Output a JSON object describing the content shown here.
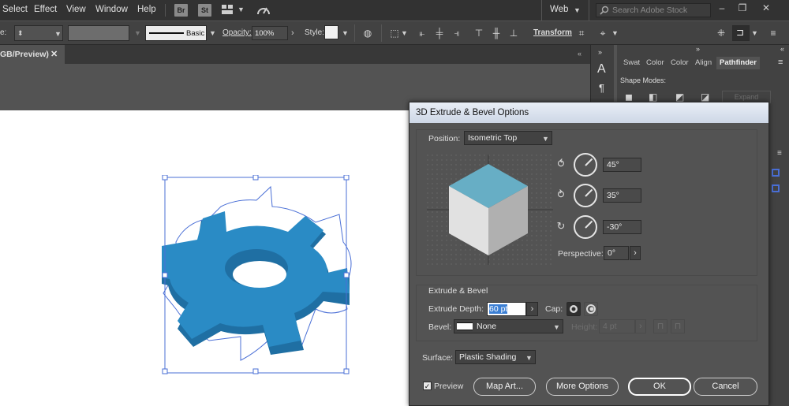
{
  "menubar": {
    "items": [
      "Select",
      "Effect",
      "View",
      "Window",
      "Help"
    ],
    "bridge": "Br",
    "stock": "St",
    "workspace": "Web",
    "search_placeholder": "Search Adobe Stock"
  },
  "controlbar": {
    "stroke_style": "Basic",
    "opacity_label": "Opacity:",
    "opacity_value": "100%",
    "style_label": "Style:",
    "transform": "Transform"
  },
  "document": {
    "tab_title": "GB/Preview)"
  },
  "panel": {
    "tabs": [
      "Swat",
      "Color",
      "Color",
      "Align",
      "Pathfinder"
    ],
    "shape_modes": "Shape Modes:",
    "expand": "Expand"
  },
  "dialog": {
    "title": "3D Extrude & Bevel Options",
    "position_label": "Position:",
    "position_value": "Isometric Top",
    "x_angle": "45°",
    "y_angle": "35°",
    "z_angle": "-30°",
    "perspective_label": "Perspective:",
    "perspective_value": "0°",
    "extrude_section": "Extrude & Bevel",
    "extrude_depth_label": "Extrude Depth:",
    "extrude_depth_value": "60 pt",
    "cap_label": "Cap:",
    "bevel_label": "Bevel:",
    "bevel_value": "None",
    "height_label": "Height:",
    "height_value": "4 pt",
    "surface_label": "Surface:",
    "surface_value": "Plastic Shading",
    "preview_label": "Preview",
    "map_art": "Map Art...",
    "more_options": "More Options",
    "ok": "OK",
    "cancel": "Cancel"
  },
  "colors": {
    "gear_top": "#2a8bc5",
    "gear_side": "#1f6fa3",
    "cube_top": "#67aec5",
    "cube_left": "#e1e1e1",
    "cube_right": "#b0b0b0",
    "selection": "#4a6fd6"
  }
}
